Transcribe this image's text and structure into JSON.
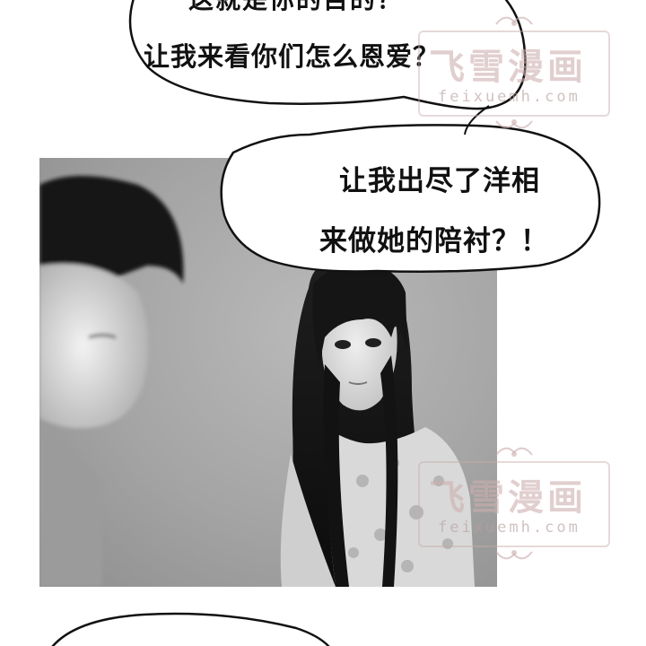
{
  "bubbles": [
    {
      "lines": [
        "这就是你的目的？",
        "让我来看你们怎么恩爱？"
      ]
    },
    {
      "lines": [
        "让我出尽了洋相",
        "来做她的陪衬？！"
      ]
    }
  ],
  "watermark": {
    "title": "飞雪漫画",
    "url": "feixuemh.com"
  },
  "colors": {
    "ink": "#111111",
    "watermark": "#c9a9a9"
  }
}
